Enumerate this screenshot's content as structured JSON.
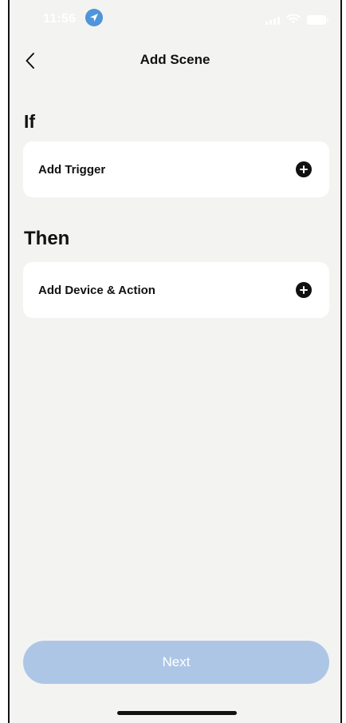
{
  "status_bar": {
    "time": "11:56",
    "location_icon": "location-arrow-icon",
    "signal_icon": "signal-icon",
    "wifi_icon": "wifi-icon",
    "battery_icon": "battery-icon"
  },
  "header": {
    "title": "Add Scene",
    "back_icon": "chevron-left-icon"
  },
  "if_section": {
    "label": "If",
    "card_label": "Add Trigger",
    "card_icon": "plus-circle-icon"
  },
  "then_section": {
    "label": "Then",
    "card_label": "Add Device & Action",
    "card_icon": "plus-circle-icon"
  },
  "footer": {
    "next_label": "Next"
  },
  "colors": {
    "background": "#f3f3f2",
    "card": "#ffffff",
    "text": "#111111",
    "button_disabled": "#aec6e6",
    "location_badge": "#4e95d9"
  }
}
